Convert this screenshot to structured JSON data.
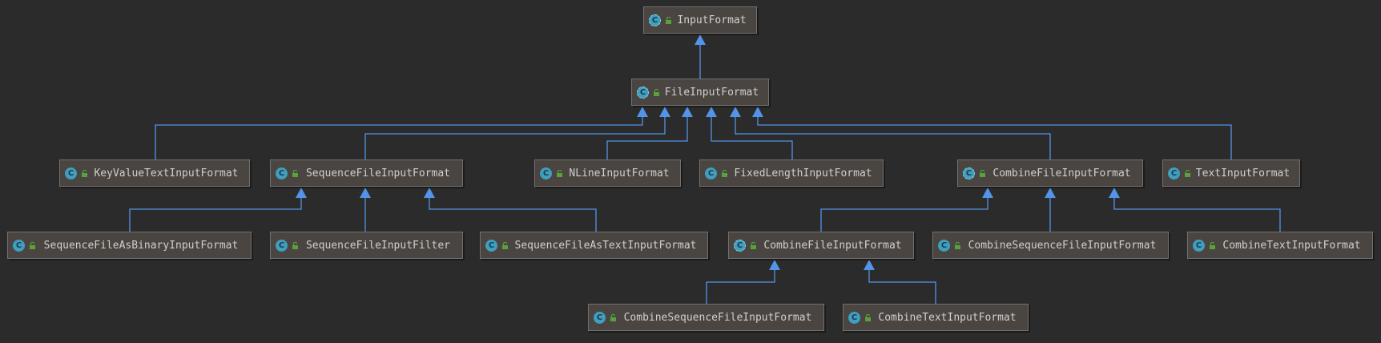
{
  "diagram": {
    "nodes": [
      {
        "id": "input-format",
        "label": "InputFormat",
        "kind": "abstract-class",
        "icon": "abstract-class-icon"
      },
      {
        "id": "file-input-format",
        "label": "FileInputFormat",
        "kind": "abstract-class",
        "icon": "abstract-class-icon"
      },
      {
        "id": "key-value-text-input-format",
        "label": "KeyValueTextInputFormat",
        "kind": "class",
        "icon": "class-icon"
      },
      {
        "id": "sequence-file-input-format",
        "label": "SequenceFileInputFormat",
        "kind": "class",
        "icon": "class-icon"
      },
      {
        "id": "nline-input-format",
        "label": "NLineInputFormat",
        "kind": "class",
        "icon": "class-icon"
      },
      {
        "id": "fixed-length-input-format",
        "label": "FixedLengthInputFormat",
        "kind": "class",
        "icon": "class-icon"
      },
      {
        "id": "combine-file-input-format-mapred",
        "label": "CombineFileInputFormat",
        "kind": "abstract-class",
        "icon": "abstract-class-icon"
      },
      {
        "id": "text-input-format",
        "label": "TextInputFormat",
        "kind": "class",
        "icon": "class-icon"
      },
      {
        "id": "sequence-file-as-binary-input-format",
        "label": "SequenceFileAsBinaryInputFormat",
        "kind": "class",
        "icon": "class-icon"
      },
      {
        "id": "sequence-file-input-filter",
        "label": "SequenceFileInputFilter",
        "kind": "class",
        "icon": "class-icon"
      },
      {
        "id": "sequence-file-as-text-input-format",
        "label": "SequenceFileAsTextInputFormat",
        "kind": "class",
        "icon": "class-icon"
      },
      {
        "id": "combine-file-input-format-lib",
        "label": "CombineFileInputFormat",
        "kind": "abstract-class",
        "icon": "abstract-class-icon"
      },
      {
        "id": "combine-sequence-file-input-format-a",
        "label": "CombineSequenceFileInputFormat",
        "kind": "class",
        "icon": "class-icon"
      },
      {
        "id": "combine-text-input-format-a",
        "label": "CombineTextInputFormat",
        "kind": "class",
        "icon": "class-icon"
      },
      {
        "id": "combine-sequence-file-input-format-b",
        "label": "CombineSequenceFileInputFormat",
        "kind": "class",
        "icon": "class-icon"
      },
      {
        "id": "combine-text-input-format-b",
        "label": "CombineTextInputFormat",
        "kind": "class",
        "icon": "class-icon"
      }
    ],
    "edges": [
      {
        "from": "file-input-format",
        "to": "input-format"
      },
      {
        "from": "key-value-text-input-format",
        "to": "file-input-format"
      },
      {
        "from": "sequence-file-input-format",
        "to": "file-input-format"
      },
      {
        "from": "nline-input-format",
        "to": "file-input-format"
      },
      {
        "from": "fixed-length-input-format",
        "to": "file-input-format"
      },
      {
        "from": "combine-file-input-format-mapred",
        "to": "file-input-format"
      },
      {
        "from": "text-input-format",
        "to": "file-input-format"
      },
      {
        "from": "sequence-file-as-binary-input-format",
        "to": "sequence-file-input-format"
      },
      {
        "from": "sequence-file-input-filter",
        "to": "sequence-file-input-format"
      },
      {
        "from": "sequence-file-as-text-input-format",
        "to": "sequence-file-input-format"
      },
      {
        "from": "combine-file-input-format-lib",
        "to": "combine-file-input-format-mapred"
      },
      {
        "from": "combine-sequence-file-input-format-a",
        "to": "combine-file-input-format-mapred"
      },
      {
        "from": "combine-text-input-format-a",
        "to": "combine-file-input-format-mapred"
      },
      {
        "from": "combine-sequence-file-input-format-b",
        "to": "combine-file-input-format-lib"
      },
      {
        "from": "combine-text-input-format-b",
        "to": "combine-file-input-format-lib"
      }
    ],
    "colors": {
      "background": "#2b2b2b",
      "node_fill": "#4a4540",
      "node_border": "#707070",
      "text": "#d0d0d0",
      "arrow": "#5393e8",
      "class_icon": "#3f9fc0",
      "visibility_icon": "#5aa13c"
    }
  }
}
